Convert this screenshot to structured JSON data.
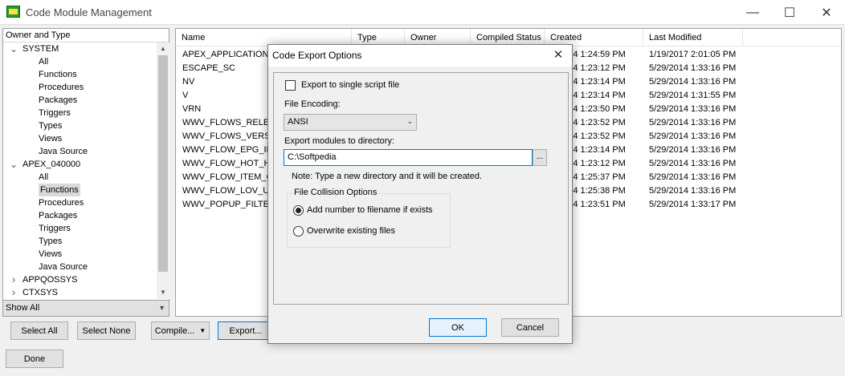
{
  "window": {
    "title": "Code Module Management",
    "minimize": "—",
    "maximize": "☐",
    "close": "✕"
  },
  "tree": {
    "header": "Owner and Type",
    "nodes": [
      {
        "label": "SYSTEM",
        "level": 0,
        "expanded": true
      },
      {
        "label": "All",
        "level": 1
      },
      {
        "label": "Functions",
        "level": 1
      },
      {
        "label": "Procedures",
        "level": 1
      },
      {
        "label": "Packages",
        "level": 1
      },
      {
        "label": "Triggers",
        "level": 1
      },
      {
        "label": "Types",
        "level": 1
      },
      {
        "label": "Views",
        "level": 1
      },
      {
        "label": "Java Source",
        "level": 1
      },
      {
        "label": "APEX_040000",
        "level": 0,
        "expanded": true
      },
      {
        "label": "All",
        "level": 1
      },
      {
        "label": "Functions",
        "level": 1,
        "selected": true
      },
      {
        "label": "Procedures",
        "level": 1
      },
      {
        "label": "Packages",
        "level": 1
      },
      {
        "label": "Triggers",
        "level": 1
      },
      {
        "label": "Types",
        "level": 1
      },
      {
        "label": "Views",
        "level": 1
      },
      {
        "label": "Java Source",
        "level": 1
      },
      {
        "label": "APPQOSSYS",
        "level": 0,
        "expanded": false
      },
      {
        "label": "CTXSYS",
        "level": 0,
        "expanded": false
      }
    ],
    "filter": "Show All"
  },
  "list": {
    "columns": [
      "Name",
      "Type",
      "Owner",
      "Compiled Status",
      "Created",
      "Last Modified"
    ],
    "rows": [
      {
        "name": "APEX_APPLICATION_C",
        "created": "2014 1:24:59 PM",
        "modified": "1/19/2017 2:01:05 PM"
      },
      {
        "name": "ESCAPE_SC",
        "created": "2014 1:23:12 PM",
        "modified": "5/29/2014 1:33:16 PM"
      },
      {
        "name": "NV",
        "created": "2014 1:23:14 PM",
        "modified": "5/29/2014 1:33:16 PM"
      },
      {
        "name": "V",
        "created": "2014 1:23:14 PM",
        "modified": "5/29/2014 1:31:55 PM"
      },
      {
        "name": "VRN",
        "created": "2014 1:23:50 PM",
        "modified": "5/29/2014 1:33:16 PM"
      },
      {
        "name": "WWV_FLOWS_RELEAS",
        "created": "2014 1:23:52 PM",
        "modified": "5/29/2014 1:33:16 PM"
      },
      {
        "name": "WWV_FLOWS_VERSIC",
        "created": "2014 1:23:52 PM",
        "modified": "5/29/2014 1:33:16 PM"
      },
      {
        "name": "WWV_FLOW_EPG_INC",
        "created": "2014 1:23:14 PM",
        "modified": "5/29/2014 1:33:16 PM"
      },
      {
        "name": "WWV_FLOW_HOT_HT",
        "created": "2014 1:23:12 PM",
        "modified": "5/29/2014 1:33:16 PM"
      },
      {
        "name": "WWV_FLOW_ITEM_CC",
        "created": "2014 1:25:37 PM",
        "modified": "5/29/2014 1:33:16 PM"
      },
      {
        "name": "WWV_FLOW_LOV_USI",
        "created": "2014 1:25:38 PM",
        "modified": "5/29/2014 1:33:16 PM"
      },
      {
        "name": "WWV_POPUP_FILTER",
        "created": "2014 1:23:51 PM",
        "modified": "5/29/2014 1:33:17 PM"
      }
    ]
  },
  "toolbar": {
    "select_all": "Select All",
    "select_none": "Select None",
    "compile": "Compile...",
    "export": "Export...",
    "done": "Done"
  },
  "dialog": {
    "title": "Code Export Options",
    "single_script_label": "Export to single script file",
    "single_script_checked": false,
    "encoding_label": "File Encoding:",
    "encoding_value": "ANSI",
    "dir_label": "Export modules to directory:",
    "dir_value": "C:\\Softpedia",
    "browse": "...",
    "note": "Note:  Type a new directory and it will be created.",
    "collision_title": "File Collision Options",
    "collision_options": [
      {
        "label": "Add number to filename if exists",
        "selected": true
      },
      {
        "label": "Overwrite existing files",
        "selected": false
      }
    ],
    "ok": "OK",
    "cancel": "Cancel"
  }
}
